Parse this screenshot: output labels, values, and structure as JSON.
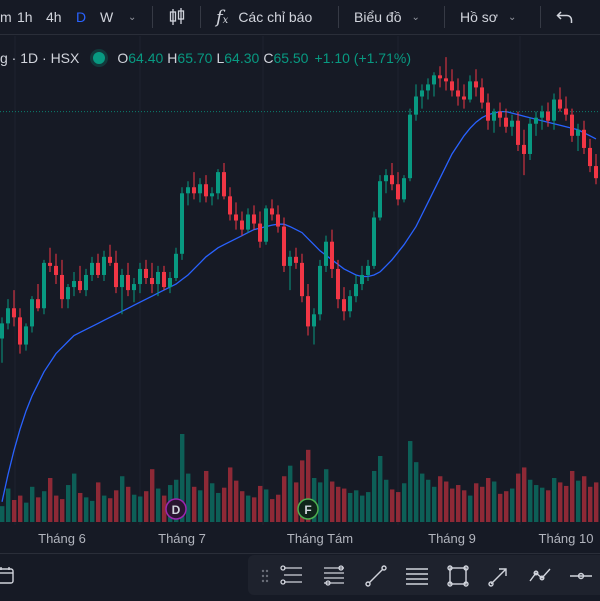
{
  "toolbar": {
    "intervals": [
      "m",
      "1h",
      "4h",
      "D",
      "W"
    ],
    "active_interval": "D",
    "indicators_label": "Các chỉ báo",
    "charts_label": "Biểu đồ",
    "profile_label": "Hồ sơ",
    "icons": [
      "interval-dropdown-icon",
      "candlestick-icon",
      "fx-icon",
      "chevron-down-icon",
      "undo-icon"
    ]
  },
  "legend": {
    "symbol_text": "g · 1D · HSX",
    "open_label": "O",
    "open": "64.40",
    "high_label": "H",
    "high": "65.70",
    "low_label": "L",
    "low": "64.30",
    "close_label": "C",
    "close": "65.50",
    "change": "+1.10 (+1.71%)"
  },
  "colors": {
    "background": "#161a25",
    "up": "#089981",
    "down": "#f23645",
    "ma_line": "#2962ff",
    "text": "#d1d4dc"
  },
  "chart_data": {
    "type": "candlestick",
    "x_labels": [
      "Tháng 6",
      "Tháng 7",
      "Tháng Tám",
      "Tháng 9",
      "Tháng 10"
    ],
    "last_close": 65.5,
    "ylim": [
      52,
      68
    ],
    "candles": [
      [
        58.0,
        58.7,
        57.2,
        58.5
      ],
      [
        58.5,
        59.3,
        58.3,
        59.0
      ],
      [
        59.0,
        59.6,
        58.4,
        58.7
      ],
      [
        58.7,
        59.0,
        57.5,
        57.8
      ],
      [
        57.8,
        58.5,
        57.6,
        58.4
      ],
      [
        58.4,
        59.4,
        58.2,
        59.3
      ],
      [
        59.3,
        59.8,
        58.9,
        59.0
      ],
      [
        59.0,
        60.6,
        58.8,
        60.5
      ],
      [
        60.5,
        61.0,
        60.2,
        60.4
      ],
      [
        60.4,
        60.8,
        59.8,
        60.1
      ],
      [
        60.1,
        60.6,
        59.0,
        59.3
      ],
      [
        59.3,
        59.8,
        59.0,
        59.7
      ],
      [
        59.7,
        60.2,
        59.4,
        59.9
      ],
      [
        59.9,
        60.4,
        59.5,
        59.6
      ],
      [
        59.6,
        60.3,
        59.4,
        60.1
      ],
      [
        60.1,
        60.7,
        59.9,
        60.5
      ],
      [
        60.5,
        60.8,
        60.0,
        60.1
      ],
      [
        60.1,
        60.9,
        59.9,
        60.7
      ],
      [
        60.7,
        61.1,
        60.4,
        60.5
      ],
      [
        60.5,
        60.9,
        59.5,
        59.7
      ],
      [
        59.7,
        60.3,
        58.8,
        60.1
      ],
      [
        60.1,
        60.5,
        59.4,
        59.6
      ],
      [
        59.6,
        60.0,
        59.2,
        59.8
      ],
      [
        59.8,
        60.5,
        59.5,
        60.3
      ],
      [
        60.3,
        60.6,
        59.8,
        60.0
      ],
      [
        60.0,
        60.5,
        59.5,
        59.8
      ],
      [
        59.8,
        60.4,
        59.4,
        60.2
      ],
      [
        60.2,
        60.4,
        59.6,
        59.7
      ],
      [
        59.7,
        60.2,
        59.5,
        60.0
      ],
      [
        60.0,
        61.0,
        59.9,
        60.8
      ],
      [
        60.8,
        63.0,
        60.6,
        62.8
      ],
      [
        62.8,
        63.2,
        62.4,
        63.0
      ],
      [
        63.0,
        63.5,
        62.6,
        62.8
      ],
      [
        62.8,
        63.3,
        62.5,
        63.1
      ],
      [
        63.1,
        63.4,
        62.5,
        62.7
      ],
      [
        62.7,
        63.0,
        62.4,
        62.8
      ],
      [
        62.8,
        63.6,
        62.6,
        63.5
      ],
      [
        63.5,
        63.8,
        62.6,
        62.7
      ],
      [
        62.7,
        63.0,
        61.9,
        62.1
      ],
      [
        62.1,
        62.5,
        61.6,
        61.9
      ],
      [
        61.9,
        62.2,
        61.4,
        61.6
      ],
      [
        61.6,
        62.3,
        61.5,
        62.1
      ],
      [
        62.1,
        62.4,
        61.6,
        61.8
      ],
      [
        61.8,
        62.2,
        61.0,
        61.2
      ],
      [
        61.2,
        62.4,
        61.1,
        62.3
      ],
      [
        62.3,
        62.6,
        61.9,
        62.1
      ],
      [
        62.1,
        62.4,
        61.5,
        61.7
      ],
      [
        61.7,
        62.0,
        60.2,
        60.4
      ],
      [
        60.4,
        60.9,
        59.6,
        60.7
      ],
      [
        60.7,
        61.0,
        60.3,
        60.5
      ],
      [
        60.5,
        60.8,
        59.2,
        59.4
      ],
      [
        59.4,
        59.8,
        58.1,
        58.4
      ],
      [
        58.4,
        59.0,
        57.8,
        58.8
      ],
      [
        58.8,
        60.6,
        58.6,
        60.4
      ],
      [
        60.4,
        61.4,
        60.2,
        61.2
      ],
      [
        61.2,
        61.6,
        60.0,
        60.3
      ],
      [
        60.3,
        60.6,
        59.0,
        59.3
      ],
      [
        59.3,
        59.7,
        58.6,
        58.9
      ],
      [
        58.9,
        59.6,
        58.7,
        59.4
      ],
      [
        59.4,
        60.1,
        59.2,
        59.8
      ],
      [
        59.8,
        60.4,
        59.6,
        60.1
      ],
      [
        60.1,
        60.6,
        59.9,
        60.4
      ],
      [
        60.4,
        62.2,
        60.3,
        62.0
      ],
      [
        62.0,
        63.4,
        61.9,
        63.2
      ],
      [
        63.2,
        63.6,
        62.8,
        63.4
      ],
      [
        63.4,
        63.8,
        62.9,
        63.1
      ],
      [
        63.1,
        63.5,
        62.4,
        62.6
      ],
      [
        62.6,
        63.4,
        62.5,
        63.3
      ],
      [
        63.3,
        65.6,
        63.2,
        65.4
      ],
      [
        65.4,
        66.4,
        65.2,
        66.0
      ],
      [
        66.0,
        66.4,
        65.6,
        66.2
      ],
      [
        66.2,
        66.6,
        65.9,
        66.4
      ],
      [
        66.4,
        66.8,
        66.0,
        66.7
      ],
      [
        66.7,
        67.0,
        66.3,
        66.6
      ],
      [
        66.6,
        67.3,
        66.2,
        66.5
      ],
      [
        66.5,
        66.9,
        66.0,
        66.2
      ],
      [
        66.2,
        66.6,
        65.7,
        66.0
      ],
      [
        66.0,
        66.4,
        65.6,
        65.9
      ],
      [
        65.9,
        66.7,
        65.8,
        66.5
      ],
      [
        66.5,
        66.9,
        66.0,
        66.3
      ],
      [
        66.3,
        66.6,
        65.6,
        65.8
      ],
      [
        65.8,
        66.1,
        64.9,
        65.2
      ],
      [
        65.2,
        65.6,
        64.8,
        65.5
      ],
      [
        65.5,
        65.8,
        65.0,
        65.3
      ],
      [
        65.3,
        65.6,
        64.8,
        65.0
      ],
      [
        65.0,
        65.4,
        64.7,
        65.2
      ],
      [
        65.2,
        65.5,
        64.2,
        64.4
      ],
      [
        64.4,
        64.9,
        63.4,
        64.1
      ],
      [
        64.1,
        65.3,
        63.9,
        65.1
      ],
      [
        65.1,
        65.5,
        64.7,
        65.3
      ],
      [
        65.3,
        65.7,
        64.9,
        65.5
      ],
      [
        65.5,
        65.8,
        65.0,
        65.2
      ],
      [
        65.2,
        66.1,
        64.9,
        65.9
      ],
      [
        65.9,
        66.3,
        65.5,
        65.6
      ],
      [
        65.6,
        66.0,
        65.2,
        65.4
      ],
      [
        65.4,
        65.6,
        64.5,
        64.7
      ],
      [
        64.7,
        65.1,
        64.2,
        64.9
      ],
      [
        64.9,
        65.2,
        64.1,
        64.3
      ],
      [
        64.3,
        64.6,
        63.5,
        63.7
      ],
      [
        63.7,
        64.1,
        63.1,
        63.3
      ]
    ],
    "moving_average": [
      52.6,
      53.5,
      54.3,
      55.0,
      55.6,
      56.1,
      56.5,
      56.9,
      57.2,
      57.5,
      57.7,
      57.9,
      58.1,
      58.2,
      58.3,
      58.4,
      58.5,
      58.6,
      58.7,
      58.8,
      58.9,
      59.0,
      59.1,
      59.2,
      59.3,
      59.4,
      59.5,
      59.6,
      59.7,
      59.8,
      59.95,
      60.1,
      60.3,
      60.5,
      60.7,
      60.85,
      61.0,
      61.1,
      61.2,
      61.3,
      61.4,
      61.5,
      61.6,
      61.65,
      61.7,
      61.75,
      61.78,
      61.78,
      61.7,
      61.6,
      61.5,
      61.3,
      61.1,
      60.9,
      60.75,
      60.6,
      60.45,
      60.3,
      60.2,
      60.1,
      60.05,
      60.05,
      60.1,
      60.2,
      60.4,
      60.6,
      60.85,
      61.1,
      61.4,
      61.7,
      62.1,
      62.5,
      62.9,
      63.3,
      63.7,
      64.1,
      64.4,
      64.7,
      64.95,
      65.15,
      65.3,
      65.4,
      65.45,
      65.5,
      65.5,
      65.45,
      65.4,
      65.35,
      65.3,
      65.25,
      65.2,
      65.15,
      65.1,
      65.05,
      65.0,
      64.95,
      64.9,
      64.8,
      64.7,
      64.6
    ],
    "volume": [
      0.18,
      0.38,
      0.25,
      0.3,
      0.22,
      0.4,
      0.28,
      0.35,
      0.5,
      0.3,
      0.26,
      0.42,
      0.55,
      0.33,
      0.28,
      0.24,
      0.45,
      0.3,
      0.27,
      0.36,
      0.52,
      0.4,
      0.31,
      0.29,
      0.35,
      0.6,
      0.38,
      0.3,
      0.42,
      0.48,
      1.0,
      0.55,
      0.4,
      0.36,
      0.58,
      0.44,
      0.33,
      0.39,
      0.62,
      0.47,
      0.35,
      0.3,
      0.28,
      0.41,
      0.37,
      0.26,
      0.31,
      0.52,
      0.64,
      0.45,
      0.7,
      0.82,
      0.5,
      0.45,
      0.6,
      0.46,
      0.4,
      0.38,
      0.33,
      0.36,
      0.3,
      0.34,
      0.58,
      0.75,
      0.48,
      0.37,
      0.34,
      0.44,
      0.92,
      0.68,
      0.55,
      0.48,
      0.4,
      0.52,
      0.46,
      0.38,
      0.42,
      0.36,
      0.3,
      0.44,
      0.4,
      0.5,
      0.46,
      0.32,
      0.35,
      0.38,
      0.55,
      0.62,
      0.48,
      0.42,
      0.39,
      0.36,
      0.5,
      0.45,
      0.41,
      0.58,
      0.47,
      0.52,
      0.4,
      0.45
    ],
    "markers": [
      {
        "label": "D",
        "candle_index": 29
      },
      {
        "label": "F",
        "candle_index": 51
      }
    ]
  },
  "bottombar": {
    "icons": [
      "calendar-icon"
    ]
  },
  "drawing_tools": [
    "drag-handle-icon",
    "fib-retracement-icon",
    "gann-fan-icon",
    "trend-line-icon",
    "horizontal-lines-icon",
    "rectangle-icon",
    "arrow-icon",
    "polyline-icon",
    "horizontal-line-icon"
  ]
}
